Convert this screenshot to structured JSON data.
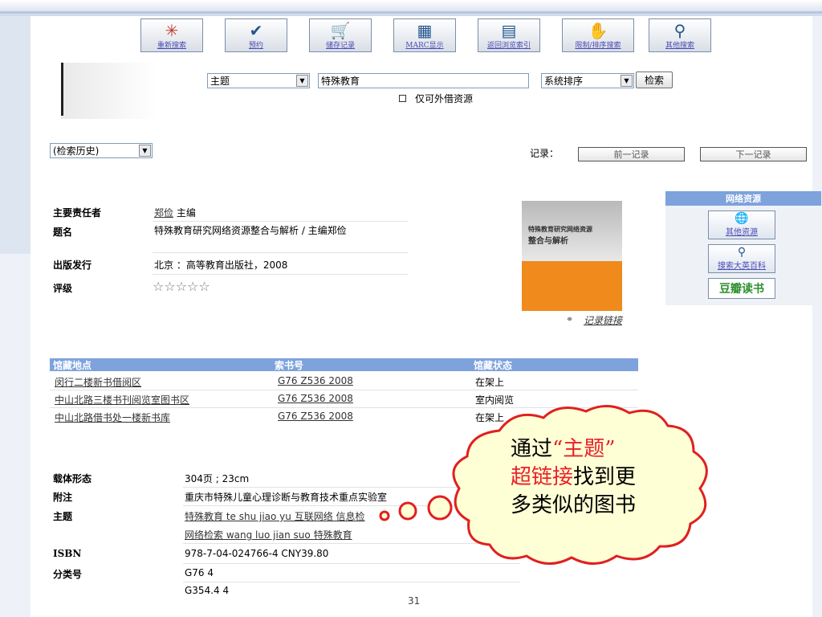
{
  "toolbar": [
    {
      "label": "重新搜索",
      "icon": "✳"
    },
    {
      "label": "预约",
      "icon": "✔"
    },
    {
      "label": "储存记录",
      "icon": "🛒"
    },
    {
      "label": "MARC显示",
      "icon": "▦"
    },
    {
      "label": "返回浏览索引",
      "icon": "▤"
    },
    {
      "label": "限制/排序搜索",
      "icon": "✋"
    },
    {
      "label": "其他搜索",
      "icon": "⚲"
    }
  ],
  "search": {
    "field": "主题",
    "query": "特殊教育",
    "sort": "系统排序",
    "submit": "检索",
    "checkbox_label": "仅可外借资源"
  },
  "history": {
    "label": "(检索历史)"
  },
  "record_nav": {
    "label": "记录：",
    "prev": "前一记录",
    "next": "下一记录"
  },
  "details": [
    {
      "label": "主要责任者",
      "value": "主编",
      "link": "郑俭"
    },
    {
      "label": "题名",
      "value": "特殊教育研究网络资源整合与解析 / 主编郑俭"
    },
    {
      "label": "出版发行",
      "value": "北京 ：高等教育出版社，2008"
    },
    {
      "label": "评级",
      "value": "☆☆☆☆☆"
    }
  ],
  "cover": {
    "title_line1": "特殊教育研究网络资源",
    "title_line2": "整合与解析"
  },
  "record_link": "记录链接",
  "network_resources": {
    "title": "网络资源",
    "items": [
      {
        "label": "其他资源",
        "icon": "🌐"
      },
      {
        "label": "搜索大英百科",
        "icon": "⚲"
      }
    ],
    "douban": "豆瓣读书"
  },
  "holdings": {
    "headers": [
      "馆藏地点",
      "索书号",
      "馆藏状态"
    ],
    "rows": [
      {
        "location": "闵行二楼新书借阅区",
        "call": "G76 Z536 2008",
        "status": "在架上"
      },
      {
        "location": "中山北路三楼书刊阅览室图书区",
        "call": "G76 Z536 2008",
        "status": "室内阅览"
      },
      {
        "location": "中山北路借书处一楼新书库",
        "call": "G76 Z536 2008",
        "status": "在架上"
      }
    ]
  },
  "more": [
    {
      "label": "载体形态",
      "value": "304页 ; 23cm"
    },
    {
      "label": "附注",
      "value": "重庆市特殊儿童心理诊断与教育技术重点实验室"
    },
    {
      "label": "主题",
      "value": "特殊教育 te shu jiao yu 互联网络 信息检"
    },
    {
      "label": "",
      "value": "网络检索 wang luo jian suo 特殊教育"
    },
    {
      "label": "ISBN",
      "value": "978-7-04-024766-4 CNY39.80"
    },
    {
      "label": "分类号",
      "value": "G76 4"
    },
    {
      "label": "",
      "value": "G354.4 4"
    }
  ],
  "callout": {
    "line1_a": "通过",
    "line1_b": "“主题”",
    "line2_a": "超链接",
    "line2_b": "找到更",
    "line3": "多类似的图书"
  },
  "page_number": "31"
}
